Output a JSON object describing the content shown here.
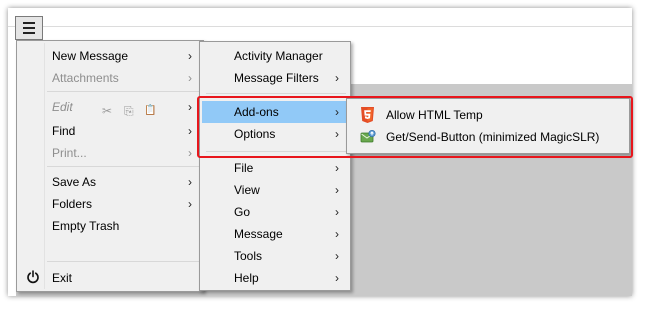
{
  "menu_main": {
    "items": [
      {
        "label": "New Message",
        "arrow": "›"
      },
      {
        "label": "Attachments",
        "arrow": "›"
      },
      {
        "label": "Edit",
        "arrow": "›",
        "icons": [
          "✂",
          "⎘",
          "📋"
        ]
      },
      {
        "label": "Find",
        "arrow": "›"
      },
      {
        "label": "Print...",
        "arrow": "›"
      },
      {
        "label": "Save As",
        "arrow": "›"
      },
      {
        "label": "Folders",
        "arrow": "›"
      },
      {
        "label": "Empty Trash"
      },
      {
        "label": "Exit",
        "icon": "power-icon"
      }
    ]
  },
  "menu_sub": {
    "items": [
      {
        "label": "Activity Manager"
      },
      {
        "label": "Message Filters",
        "arrow": "›"
      },
      {
        "label": "Add-ons",
        "arrow": "›"
      },
      {
        "label": "Options",
        "arrow": "›"
      },
      {
        "label": "File",
        "arrow": "›"
      },
      {
        "label": "View",
        "arrow": "›"
      },
      {
        "label": "Go",
        "arrow": "›"
      },
      {
        "label": "Message",
        "arrow": "›"
      },
      {
        "label": "Tools",
        "arrow": "›"
      },
      {
        "label": "Help",
        "arrow": "›"
      }
    ]
  },
  "menu_addons": {
    "items": [
      {
        "label": "Allow HTML Temp",
        "icon": "html5-icon"
      },
      {
        "label": "Get/Send-Button (minimized MagicSLR)",
        "icon": "magicslr-icon"
      }
    ]
  },
  "colors": {
    "menu_bg": "#f0f0f0",
    "highlight": "#91c9f7",
    "disabled_text": "#8e8e8e",
    "callout_border": "#e8161c",
    "app_gray": "#c9c9c9"
  }
}
